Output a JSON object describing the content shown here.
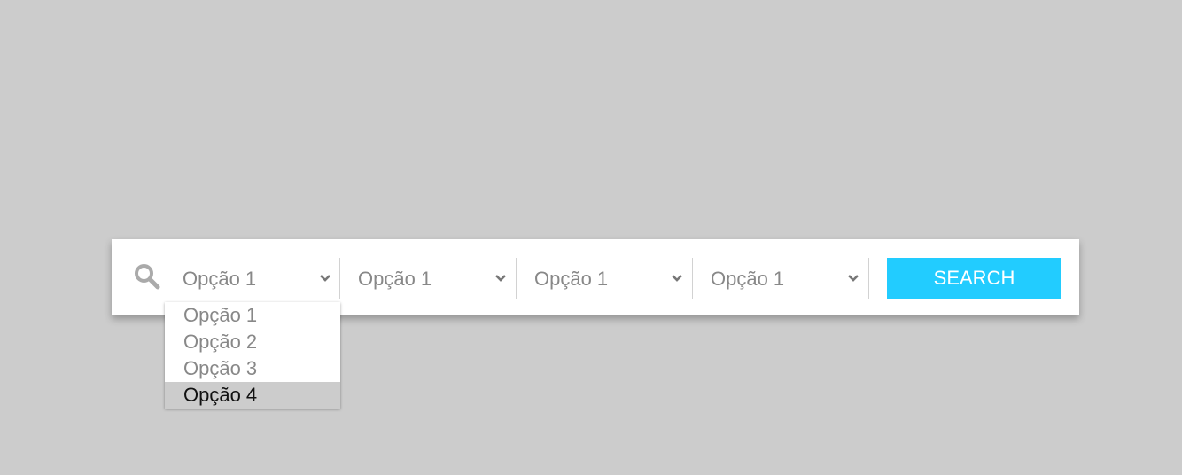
{
  "colors": {
    "background": "#cccccc",
    "bar_background": "#ffffff",
    "accent": "#22ccff",
    "text_muted": "#888888",
    "highlight": "#cccccc"
  },
  "search_bar": {
    "icon": "search-icon",
    "selects": [
      {
        "value": "Opção 1",
        "icon": "chevron-down-icon"
      },
      {
        "value": "Opção 1",
        "icon": "chevron-down-icon"
      },
      {
        "value": "Opção 1",
        "icon": "chevron-down-icon"
      },
      {
        "value": "Opção 1",
        "icon": "chevron-down-icon"
      }
    ],
    "button_label": "SEARCH"
  },
  "dropdown": {
    "open_for_select": 1,
    "options": [
      "Opção 1",
      "Opção 2",
      "Opção 3",
      "Opção 4"
    ],
    "highlighted_option": "Opção 4"
  }
}
